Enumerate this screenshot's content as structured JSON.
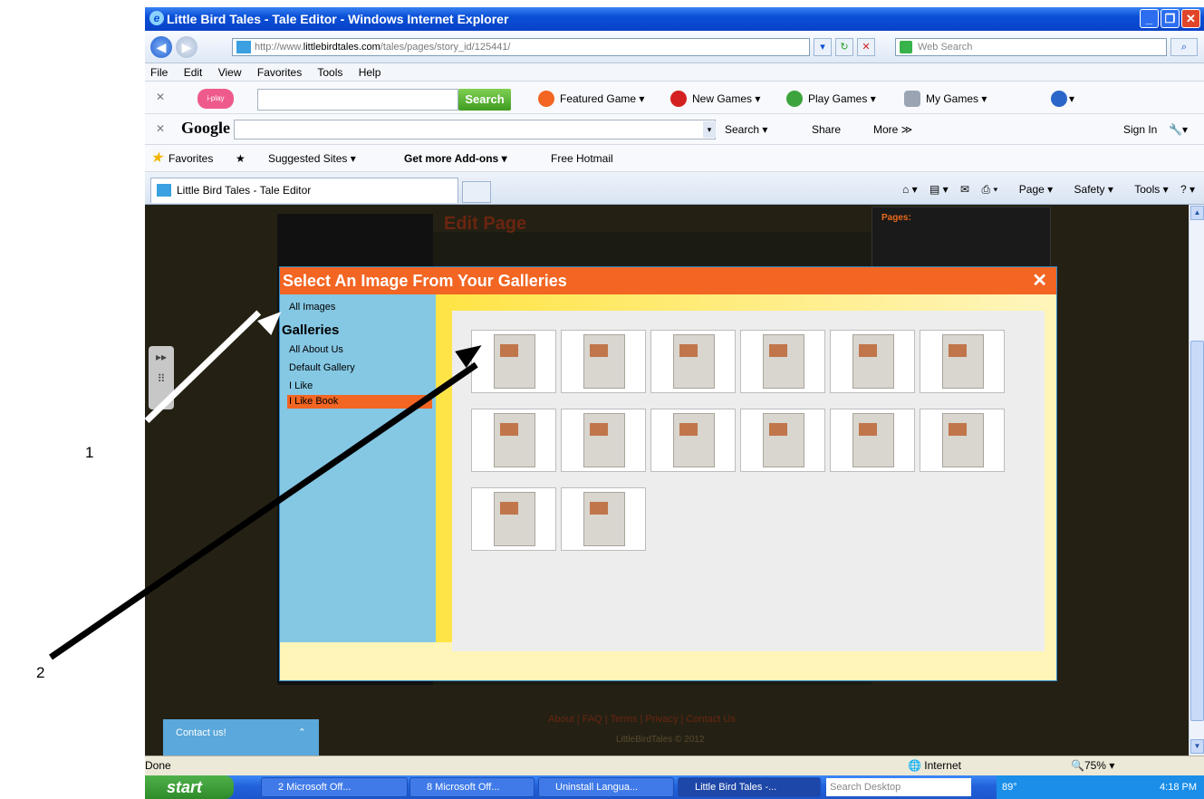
{
  "window": {
    "title": "Little Bird Tales - Tale Editor - Windows Internet Explorer",
    "min": "_",
    "max": "❐",
    "close": "✕"
  },
  "address_bar": {
    "url_prefix": "http://www.",
    "url_domain": "littlebirdtales.com",
    "url_path": "/tales/pages/story_id/125441/",
    "web_search_placeholder": "Web Search"
  },
  "menu": [
    "File",
    "Edit",
    "View",
    "Favorites",
    "Tools",
    "Help"
  ],
  "toolbar_iplay": {
    "logo": "i-play",
    "search_button": "Search",
    "featured": "Featured Game",
    "new_games": "New Games",
    "play_games": "Play Games",
    "my_games": "My Games"
  },
  "google_toolbar": {
    "logo": "Google",
    "search": "Search",
    "share": "Share",
    "more": "More ≫",
    "sign_in": "Sign In"
  },
  "favorites_bar": {
    "favorites": "Favorites",
    "suggested": "Suggested Sites",
    "addons": "Get more Add-ons",
    "hotmail": "Free Hotmail"
  },
  "tab": {
    "label": "Little Bird Tales - Tale Editor"
  },
  "command_bar": {
    "page": "Page",
    "safety": "Safety",
    "tools": "Tools"
  },
  "page": {
    "edit_page": "Edit Page",
    "pages_label": "Pages:",
    "footer_links": "About  |  FAQ  |  Terms  |  Privacy  |  Contact Us",
    "footer_copy": "LittleBirdTales © 2012",
    "contact": "Contact us!"
  },
  "modal": {
    "title": "Select An Image From Your Galleries",
    "close": "✕",
    "all_images": "All Images",
    "galleries_heading": "Galleries",
    "galleries": [
      "All About Us",
      "Default Gallery",
      "I Like",
      "I Like Book"
    ],
    "selected_gallery": "I Like Book",
    "image_count": 14
  },
  "status": {
    "left": "Done",
    "zone": "Internet",
    "zoom": "75%"
  },
  "taskbar": {
    "start": "start",
    "tasks": [
      "2 Microsoft Off...",
      "8 Microsoft Off...",
      "Uninstall Langua...",
      "Little Bird Tales -..."
    ],
    "search_placeholder": "Search Desktop",
    "temp": "89°",
    "clock": "4:18 PM"
  },
  "annotations": {
    "label_1": "1",
    "label_2": "2"
  },
  "colors": {
    "modal_header": "#f26522",
    "sidebar": "#85c8e4",
    "xp_blue": "#0a4fd6"
  }
}
